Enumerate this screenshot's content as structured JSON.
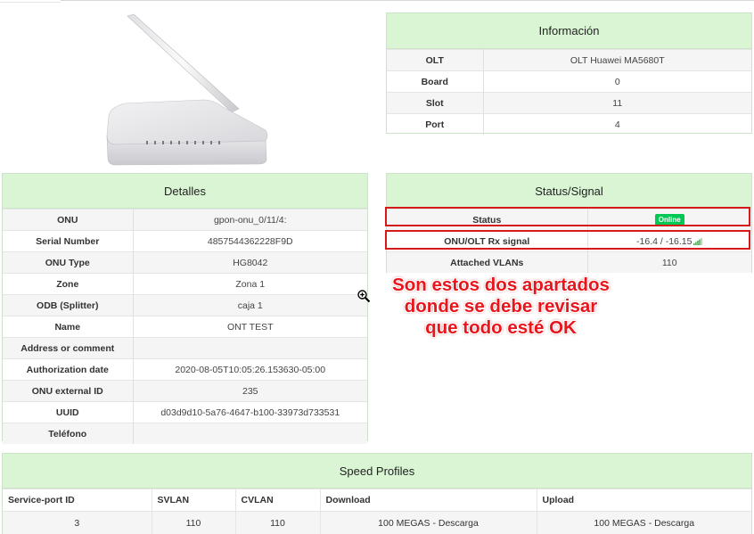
{
  "informacion": {
    "title": "Información",
    "rows": [
      {
        "k": "OLT",
        "v": "OLT Huawei MA5680T"
      },
      {
        "k": "Board",
        "v": "0"
      },
      {
        "k": "Slot",
        "v": "11"
      },
      {
        "k": "Port",
        "v": "4"
      }
    ]
  },
  "detalles": {
    "title": "Detalles",
    "rows": [
      {
        "k": "ONU",
        "v": "gpon-onu_0/11/4:"
      },
      {
        "k": "Serial Number",
        "v": "4857544362228F9D"
      },
      {
        "k": "ONU Type",
        "v": "HG8042"
      },
      {
        "k": "Zone",
        "v": "Zona 1"
      },
      {
        "k": "ODB (Splitter)",
        "v": "caja 1"
      },
      {
        "k": "Name",
        "v": "ONT TEST"
      },
      {
        "k": "Address or comment",
        "v": ""
      },
      {
        "k": "Authorization date",
        "v": "2020-08-05T10:05:26.153630-05:00"
      },
      {
        "k": "ONU external ID",
        "v": "235"
      },
      {
        "k": "UUID",
        "v": "d03d9d10-5a76-4647-b100-33973d733531"
      },
      {
        "k": "Teléfono",
        "v": ""
      }
    ]
  },
  "status_signal": {
    "title": "Status/Signal",
    "status_label": "Status",
    "status_value": "Online",
    "rx_label": "ONU/OLT Rx signal",
    "rx_value": "-16.4 / -16.15",
    "vlans_label": "Attached VLANs",
    "vlans_value": "110",
    "colors": {
      "online": "#00c853",
      "signal": "#4caf50",
      "highlight": "#d61a1a"
    }
  },
  "annotation": {
    "line1": "Son estos dos apartados",
    "line2": "donde se debe revisar",
    "line3": "que todo esté OK"
  },
  "speed_profiles": {
    "title": "Speed Profiles",
    "headers": [
      "Service-port ID",
      "SVLAN",
      "CVLAN",
      "Download",
      "Upload"
    ],
    "rows": [
      [
        "3",
        "110",
        "110",
        "100 MEGAS - Descarga",
        "100 MEGAS - Descarga"
      ]
    ]
  },
  "colors": {
    "panel_header": "#d9f5d3",
    "panel_border": "#cde3c9"
  }
}
